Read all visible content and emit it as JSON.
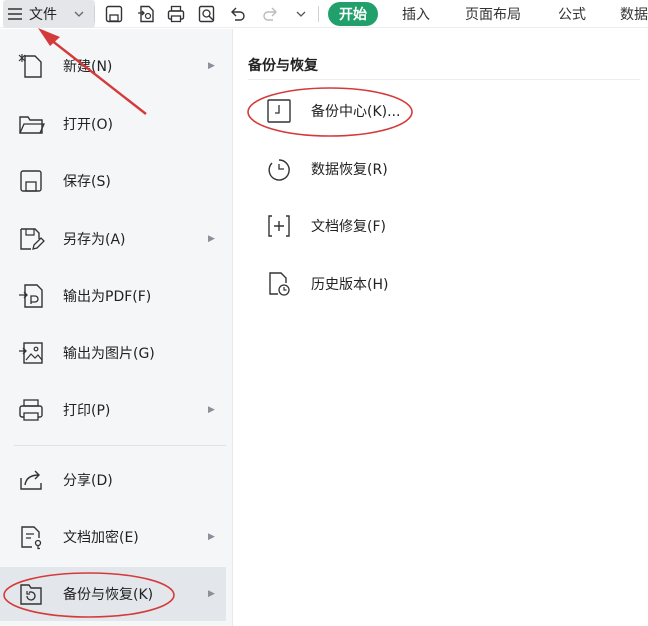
{
  "toolbar": {
    "menu_icon": "hamburger-icon",
    "file_label": "文件",
    "dropdown_icon": "chevron-down-icon",
    "quick_icons": [
      "save-icon",
      "export-pdf-icon",
      "print-icon",
      "print-preview-icon",
      "undo-icon",
      "redo-icon",
      "more-dropdown-icon"
    ],
    "tabs": [
      {
        "label": "开始",
        "active": true
      },
      {
        "label": "插入",
        "active": false
      },
      {
        "label": "页面布局",
        "active": false
      },
      {
        "label": "公式",
        "active": false
      },
      {
        "label": "数据",
        "active": false
      }
    ],
    "active_color": "#22a06b"
  },
  "sidebar": {
    "items": [
      {
        "label": "新建(N)",
        "icon": "new-document-icon",
        "has_submenu": true
      },
      {
        "label": "打开(O)",
        "icon": "folder-icon",
        "has_submenu": false
      },
      {
        "label": "保存(S)",
        "icon": "save-icon",
        "has_submenu": false
      },
      {
        "label": "另存为(A)",
        "icon": "save-as-icon",
        "has_submenu": true
      },
      {
        "label": "输出为PDF(F)",
        "icon": "pdf-export-icon",
        "has_submenu": false
      },
      {
        "label": "输出为图片(G)",
        "icon": "image-export-icon",
        "has_submenu": false
      },
      {
        "label": "打印(P)",
        "icon": "printer-icon",
        "has_submenu": true
      },
      {
        "label": "分享(D)",
        "icon": "share-icon",
        "has_submenu": false
      },
      {
        "label": "文档加密(E)",
        "icon": "encrypt-icon",
        "has_submenu": true
      },
      {
        "label": "备份与恢复(K)",
        "icon": "backup-restore-icon",
        "has_submenu": true,
        "selected": true
      }
    ]
  },
  "panel": {
    "title": "备份与恢复",
    "items": [
      {
        "label": "备份中心(K)...",
        "icon": "backup-center-icon"
      },
      {
        "label": "数据恢复(R)",
        "icon": "data-recovery-icon"
      },
      {
        "label": "文档修复(F)",
        "icon": "document-repair-icon"
      },
      {
        "label": "历史版本(H)",
        "icon": "history-version-icon"
      }
    ]
  },
  "annotation_color": "#d43a3a"
}
